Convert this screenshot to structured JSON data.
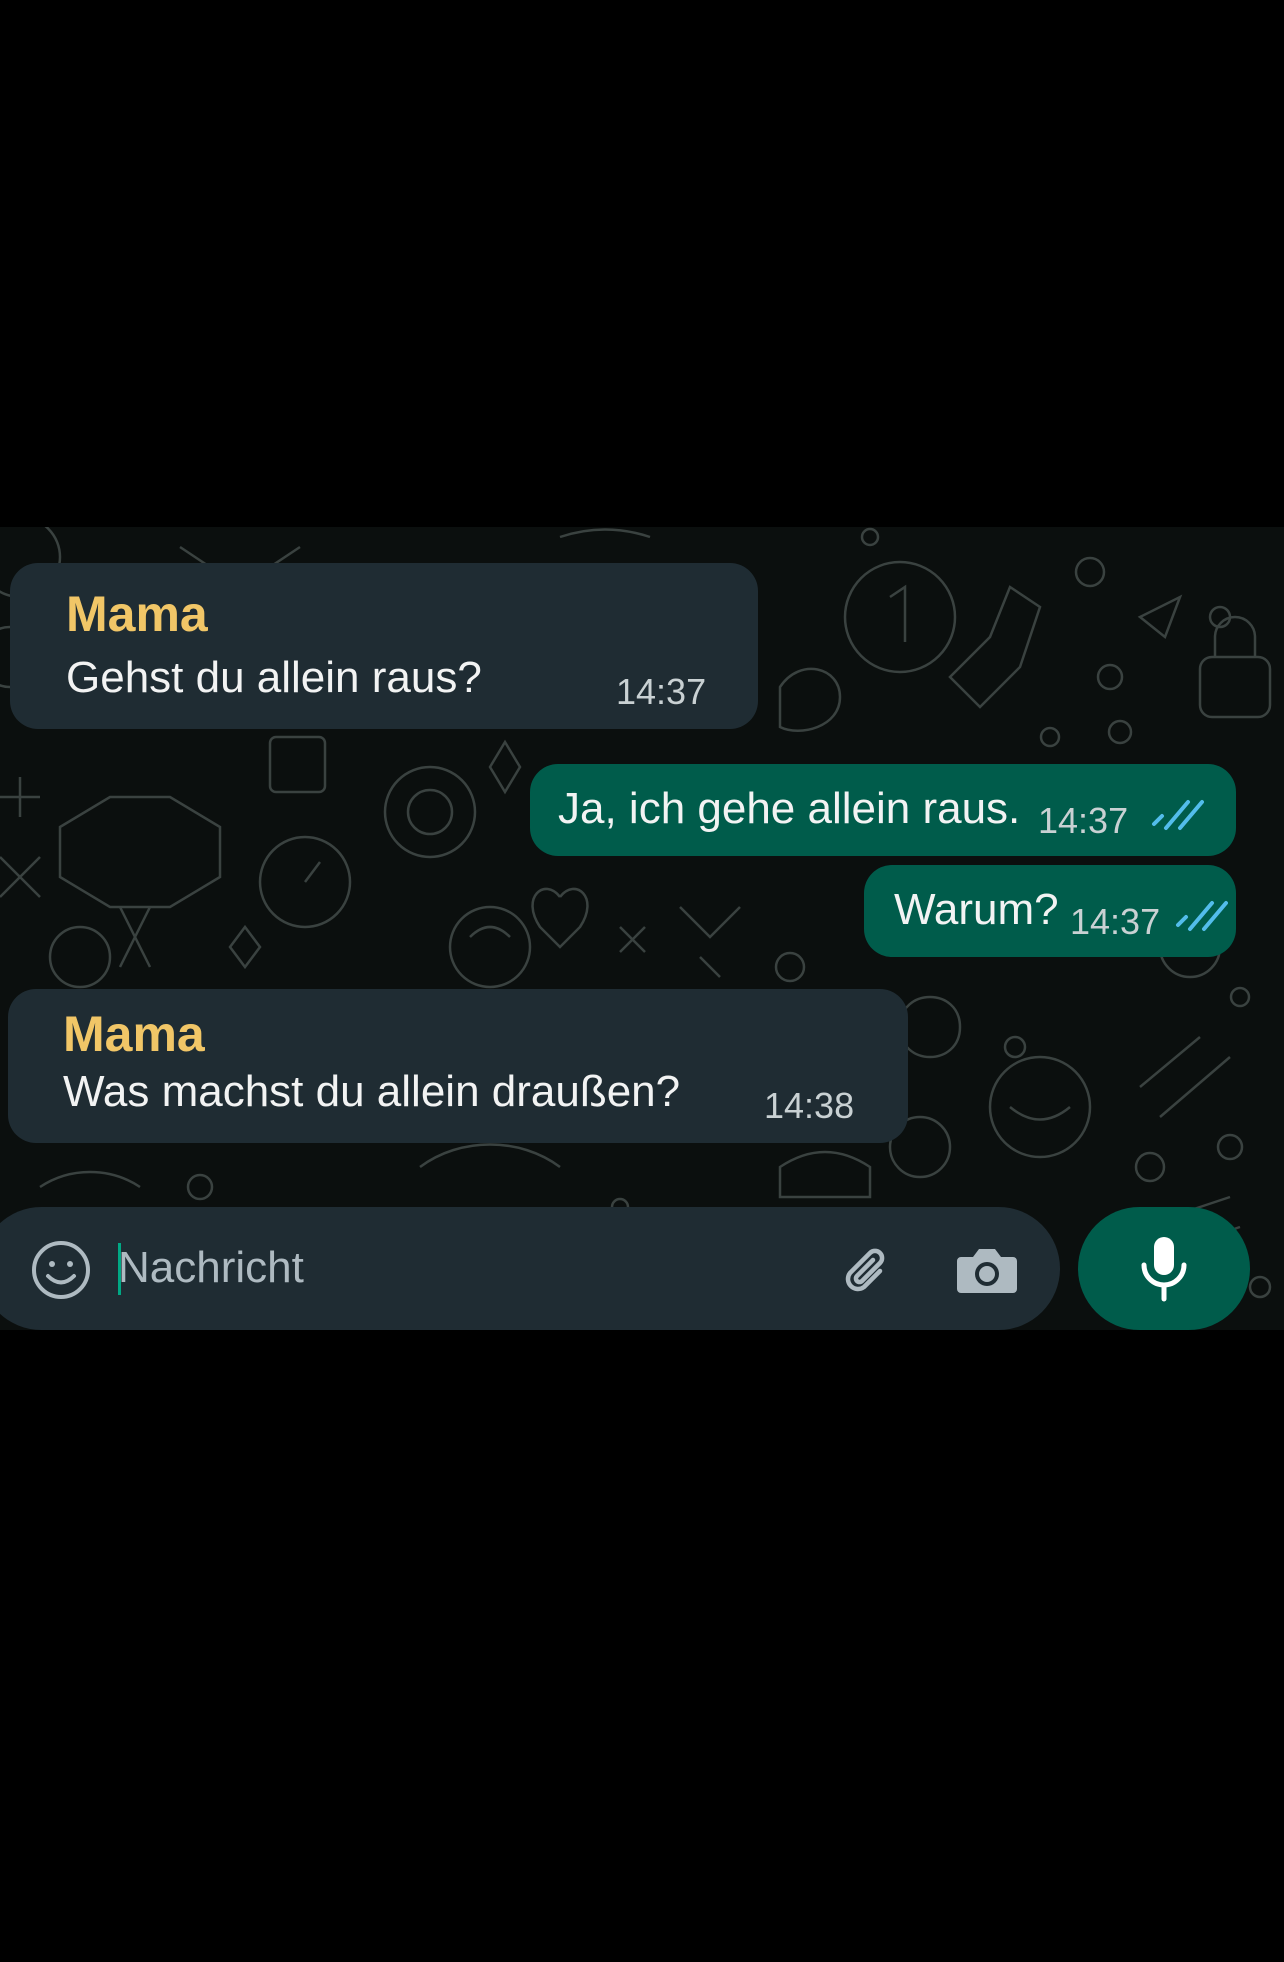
{
  "colors": {
    "page_background": "#000000",
    "chat_background": "#0b0f0e",
    "incoming_bubble": "#1f2c33",
    "outgoing_bubble": "#005c4b",
    "sender_name": "#f1c667",
    "read_ticks": "#53bdeb",
    "accent": "#00a884"
  },
  "messages": [
    {
      "direction": "incoming",
      "sender": "Mama",
      "text": "Gehst du allein raus?",
      "time": "14:37"
    },
    {
      "direction": "outgoing",
      "text": "Ja, ich gehe allein raus.",
      "time": "14:37",
      "status": "read"
    },
    {
      "direction": "outgoing",
      "text": "Warum?",
      "time": "14:37",
      "status": "read"
    },
    {
      "direction": "incoming",
      "sender": "Mama",
      "text": "Was machst du allein draußen?",
      "time": "14:38"
    }
  ],
  "composer": {
    "placeholder": "Nachricht",
    "emoji_icon": "smiley-icon",
    "attach_icon": "paperclip-icon",
    "camera_icon": "camera-icon",
    "mic_icon": "microphone-icon"
  }
}
